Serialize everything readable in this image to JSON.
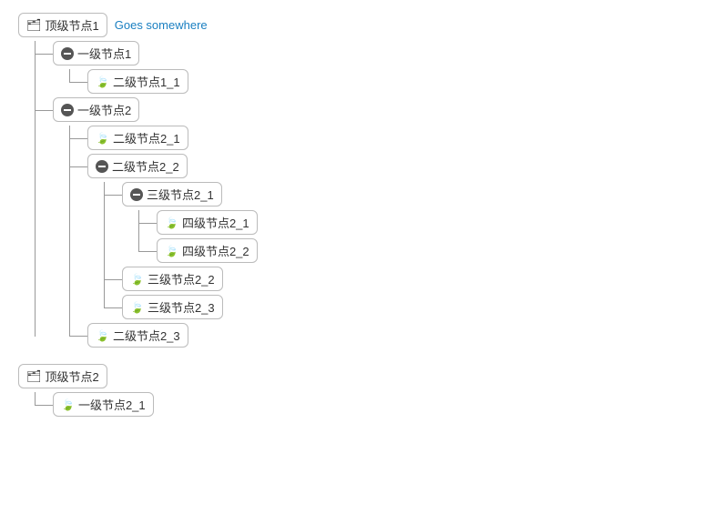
{
  "tree": [
    {
      "id": "root1",
      "label": "顶级节点1",
      "type": "folder",
      "link": "Goes somewhere",
      "children": [
        {
          "id": "node1",
          "label": "一级节点1",
          "type": "collapsible",
          "children": [
            {
              "id": "node1_1",
              "label": "二级节点1_1",
              "type": "leaf"
            }
          ]
        },
        {
          "id": "node2",
          "label": "一级节点2",
          "type": "collapsible",
          "children": [
            {
              "id": "node2_1",
              "label": "二级节点2_1",
              "type": "leaf"
            },
            {
              "id": "node2_2",
              "label": "二级节点2_2",
              "type": "collapsible",
              "children": [
                {
                  "id": "node2_2_1",
                  "label": "三级节点2_1",
                  "type": "collapsible",
                  "children": [
                    {
                      "id": "node2_2_1_1",
                      "label": "四级节点2_1",
                      "type": "leaf"
                    },
                    {
                      "id": "node2_2_1_2",
                      "label": "四级节点2_2",
                      "type": "leaf"
                    }
                  ]
                },
                {
                  "id": "node2_2_2",
                  "label": "三级节点2_2",
                  "type": "leaf"
                },
                {
                  "id": "node2_2_3",
                  "label": "三级节点2_3",
                  "type": "leaf"
                }
              ]
            },
            {
              "id": "node2_3",
              "label": "二级节点2_3",
              "type": "leaf"
            }
          ]
        }
      ]
    },
    {
      "id": "root2",
      "label": "顶级节点2",
      "type": "folder",
      "link": null,
      "children": [
        {
          "id": "node2_1_root",
          "label": "一级节点2_1",
          "type": "leaf"
        }
      ]
    }
  ],
  "icons": {
    "folder": "🗂",
    "leaf": "🍃",
    "collapse": "⊖"
  }
}
